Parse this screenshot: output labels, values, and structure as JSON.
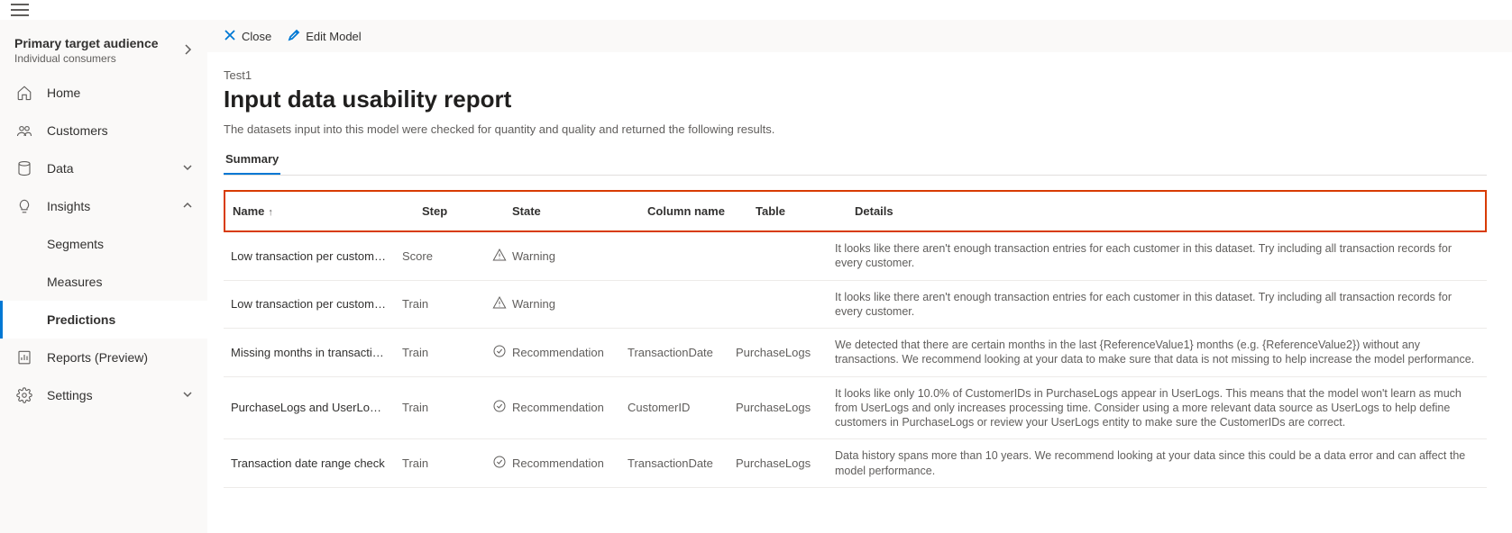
{
  "nav": {
    "header_title": "Primary target audience",
    "header_sub": "Individual consumers",
    "items": {
      "home": "Home",
      "customers": "Customers",
      "data": "Data",
      "insights": "Insights",
      "segments": "Segments",
      "measures": "Measures",
      "predictions": "Predictions",
      "reports": "Reports (Preview)",
      "settings": "Settings"
    }
  },
  "commands": {
    "close": "Close",
    "edit": "Edit Model"
  },
  "page": {
    "breadcrumb": "Test1",
    "title": "Input data usability report",
    "desc": "The datasets input into this model were checked for quantity and quality and returned the following results.",
    "tab_summary": "Summary"
  },
  "columns": {
    "name": "Name",
    "step": "Step",
    "state": "State",
    "colname": "Column name",
    "table": "Table",
    "details": "Details"
  },
  "rows": [
    {
      "name": "Low transaction per customer (s...",
      "step": "Score",
      "state_icon": "warning",
      "state": "Warning",
      "col": "",
      "table": "",
      "details": "It looks like there aren't enough transaction entries for each customer in this dataset. Try including all transaction records for every customer."
    },
    {
      "name": "Low transaction per customer (s...",
      "step": "Train",
      "state_icon": "warning",
      "state": "Warning",
      "col": "",
      "table": "",
      "details": "It looks like there aren't enough transaction entries for each customer in this dataset. Try including all transaction records for every customer."
    },
    {
      "name": "Missing months in transactions ...",
      "step": "Train",
      "state_icon": "recommendation",
      "state": "Recommendation",
      "col": "TransactionDate",
      "table": "PurchaseLogs",
      "details": "We detected that there are certain months in the last {ReferenceValue1} months (e.g. {ReferenceValue2}) without any transactions. We recommend looking at your data to make sure that data is not missing to help increase the model performance."
    },
    {
      "name": "PurchaseLogs and UserLogs cus...",
      "step": "Train",
      "state_icon": "recommendation",
      "state": "Recommendation",
      "col": "CustomerID",
      "table": "PurchaseLogs",
      "details": "It looks like only 10.0% of CustomerIDs in PurchaseLogs appear in UserLogs. This means that the model won't learn as much from UserLogs and only increases processing time. Consider using a more relevant data source as UserLogs to help define customers in PurchaseLogs or review your UserLogs entity to make sure the CustomerIDs are correct."
    },
    {
      "name": "Transaction date range check",
      "step": "Train",
      "state_icon": "recommendation",
      "state": "Recommendation",
      "col": "TransactionDate",
      "table": "PurchaseLogs",
      "details": "Data history spans more than 10 years. We recommend looking at your data since this could be a data error and can affect the model performance."
    }
  ]
}
